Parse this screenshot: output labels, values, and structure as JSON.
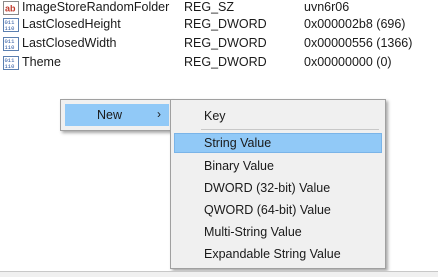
{
  "registry": {
    "rows": [
      {
        "icon": "string-value-icon",
        "name": "ImageStoreRandomFolder",
        "type": "REG_SZ",
        "data": "uvn6r06"
      },
      {
        "icon": "binary-value-icon",
        "name": "LastClosedHeight",
        "type": "REG_DWORD",
        "data": "0x000002b8 (696)"
      },
      {
        "icon": "binary-value-icon",
        "name": "LastClosedWidth",
        "type": "REG_DWORD",
        "data": "0x00000556 (1366)"
      },
      {
        "icon": "binary-value-icon",
        "name": "Theme",
        "type": "REG_DWORD",
        "data": "0x00000000 (0)"
      }
    ]
  },
  "context_menu": {
    "new_label": "New",
    "arrow": "›"
  },
  "submenu": {
    "items": [
      {
        "label": "Key"
      },
      {
        "label": "String Value"
      },
      {
        "label": "Binary Value"
      },
      {
        "label": "DWORD (32-bit) Value"
      },
      {
        "label": "QWORD (64-bit) Value"
      },
      {
        "label": "Multi-String Value"
      },
      {
        "label": "Expandable String Value"
      }
    ]
  },
  "colors": {
    "highlight": "#91c9f7",
    "menu_bg": "#f0f0f0"
  }
}
